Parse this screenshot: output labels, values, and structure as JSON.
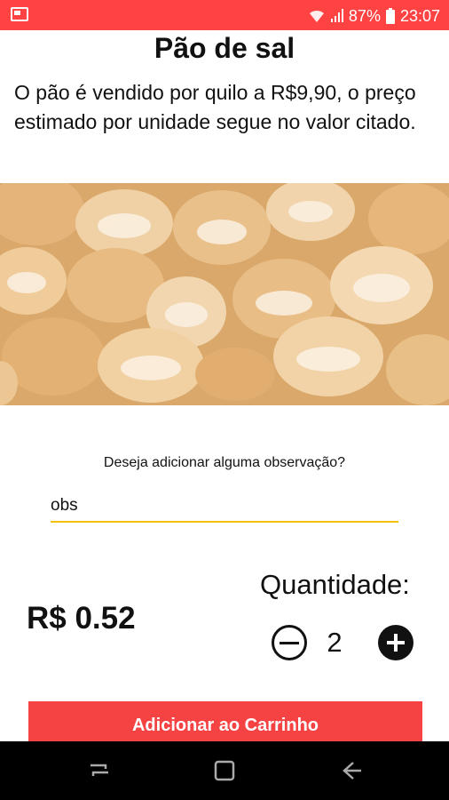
{
  "status_bar": {
    "battery_percent": "87%",
    "time": "23:07",
    "icons": [
      "notification-icon",
      "wifi-icon",
      "signal-icon",
      "battery-icon"
    ]
  },
  "product": {
    "title": "Pão de sal",
    "description": "O pão é vendido por quilo a  R$9,90, o preço estimado por unidade segue no valor citado."
  },
  "observation": {
    "label": "Deseja adicionar alguma observação?",
    "value": "obs"
  },
  "price": "R$ 0.52",
  "quantity": {
    "label": "Quantidade:",
    "value": "2"
  },
  "cart_button_label": "Adicionar ao Carrinho",
  "colors": {
    "status_bar": "#ff4242",
    "button": "#f54242",
    "input_underline": "#f2c000"
  },
  "nav_icons": [
    "recents-icon",
    "home-icon",
    "back-icon"
  ]
}
